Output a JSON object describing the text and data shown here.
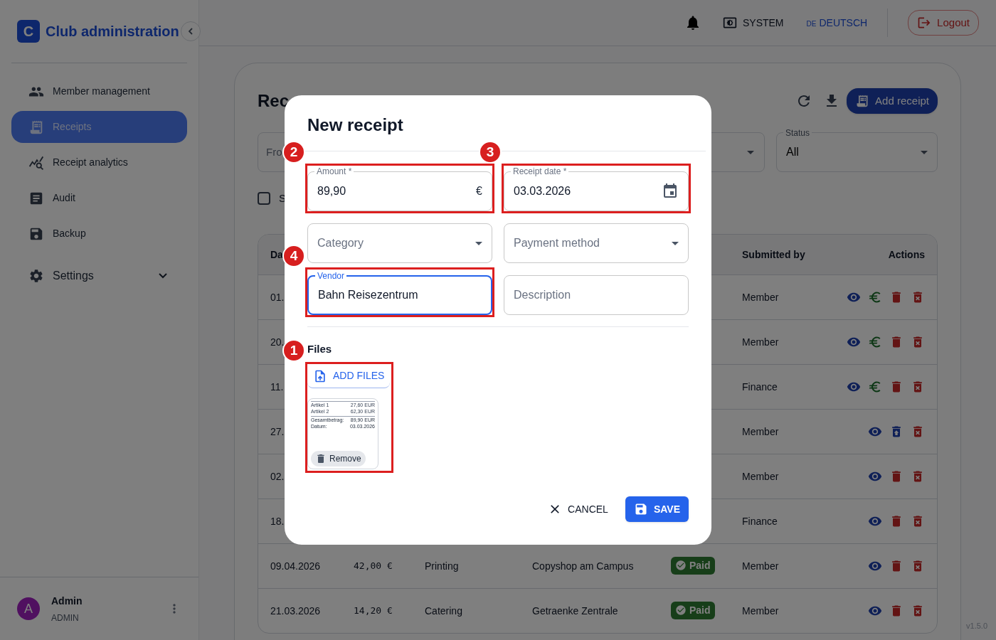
{
  "brand": {
    "logo_letter": "C",
    "title": "Club administration"
  },
  "nav": {
    "items": [
      {
        "label": "Member management",
        "selected": false
      },
      {
        "label": "Receipts",
        "selected": true
      },
      {
        "label": "Receipt analytics",
        "selected": false
      },
      {
        "label": "Audit",
        "selected": false
      },
      {
        "label": "Backup",
        "selected": false
      }
    ],
    "settings": {
      "label": "Settings",
      "expanded": false
    }
  },
  "user": {
    "initial": "A",
    "name": "Admin",
    "role": "ADMIN"
  },
  "topbar": {
    "theme": "SYSTEM",
    "language_code": "DE",
    "language": "DEUTSCH",
    "logout": "Logout"
  },
  "page": {
    "title": "Rec",
    "add_button": "Add receipt",
    "from_field": "Fro",
    "status_filter": {
      "label": "Status",
      "value": "All"
    },
    "checkbox": {
      "label": "S",
      "checked": false
    }
  },
  "table": {
    "columns": {
      "date": "Da",
      "submitted_by": "Submitted by",
      "actions": "Actions"
    },
    "rows": [
      {
        "date": "01.",
        "submitted_by": "Member",
        "actions": [
          {
            "kind": "view"
          },
          {
            "kind": "pay"
          },
          {
            "kind": "delete"
          },
          {
            "kind": "purge"
          }
        ]
      },
      {
        "date": "20.",
        "submitted_by": "Member",
        "actions": [
          {
            "kind": "view"
          },
          {
            "kind": "pay"
          },
          {
            "kind": "delete"
          },
          {
            "kind": "purge"
          }
        ]
      },
      {
        "date": "11.",
        "submitted_by": "Finance",
        "actions": [
          {
            "kind": "view"
          },
          {
            "kind": "pay"
          },
          {
            "kind": "delete"
          },
          {
            "kind": "purge"
          }
        ]
      },
      {
        "date": "27.",
        "submitted_by": "Member",
        "actions": [
          {
            "kind": "view"
          },
          {
            "kind": "restore"
          },
          {
            "kind": "purge"
          }
        ]
      },
      {
        "date": "02.",
        "submitted_by": "Member",
        "actions": [
          {
            "kind": "view"
          },
          {
            "kind": "delete"
          },
          {
            "kind": "purge"
          }
        ]
      },
      {
        "date": "18.",
        "submitted_by": "Finance",
        "actions": [
          {
            "kind": "view"
          },
          {
            "kind": "delete"
          },
          {
            "kind": "purge"
          }
        ]
      },
      {
        "date": "09.04.2026",
        "amount": "42,00 €",
        "category": "Printing",
        "vendor": "Copyshop am Campus",
        "status": {
          "kind": "paid",
          "label": "Paid"
        },
        "submitted_by": "Member",
        "actions": [
          {
            "kind": "view"
          },
          {
            "kind": "delete"
          },
          {
            "kind": "purge"
          }
        ]
      },
      {
        "date": "21.03.2026",
        "amount": "14,20 €",
        "category": "Catering",
        "vendor": "Getraenke Zentrale",
        "status": {
          "kind": "paid",
          "label": "Paid"
        },
        "submitted_by": "Member",
        "actions": [
          {
            "kind": "view"
          },
          {
            "kind": "delete"
          },
          {
            "kind": "purge"
          }
        ]
      }
    ]
  },
  "version": "v1.5.0",
  "dialog": {
    "title": "New receipt",
    "fields": [
      {
        "kind": "text",
        "label": "Amount *",
        "value": "89,90",
        "suffix": "€",
        "focused": false,
        "callout": "2"
      },
      {
        "kind": "date",
        "label": "Receipt date *",
        "value": "03.03.2026",
        "focused": false,
        "callout": "3"
      },
      {
        "kind": "select",
        "label": "Category",
        "focused": false
      },
      {
        "kind": "select",
        "label": "Payment method",
        "focused": false
      },
      {
        "kind": "text",
        "label": "Vendor",
        "value": "Bahn Reisezentrum",
        "focused": true,
        "callout": "4"
      },
      {
        "kind": "text",
        "label": "Description",
        "focused": false
      }
    ],
    "files": {
      "label": "Files",
      "add_button": "ADD FILES",
      "callout": "1",
      "preview": {
        "lines": [
          [
            "Artikel 1",
            "27,60 EUR"
          ],
          [
            "Artikel 2",
            "62,30 EUR"
          ]
        ],
        "totals": [
          [
            "Gesamtbetrag:",
            "89,90 EUR"
          ],
          [
            "Datum:",
            "03.03.2026"
          ]
        ]
      },
      "remove_button": "Remove"
    },
    "cancel": "CANCEL",
    "save": "SAVE"
  }
}
